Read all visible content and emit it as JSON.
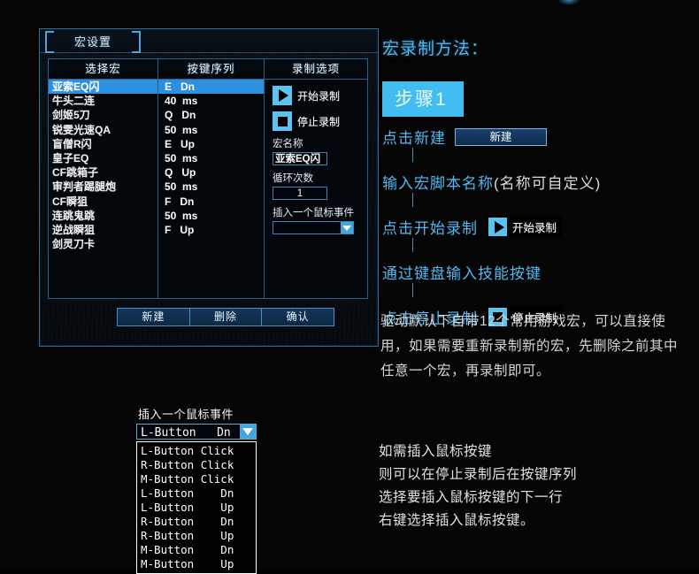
{
  "dialog": {
    "title": "宏设置",
    "columns": {
      "select_macro": "选择宏",
      "key_sequence": "按键序列",
      "record_options": "录制选项"
    },
    "macros": [
      "亚索EQ闪",
      "牛头二连",
      "剑姬5刀",
      "锐雯光速QA",
      "盲僧R闪",
      "皇子EQ",
      "CF跳箱子",
      "审判者踢腿炮",
      "CF瞬狙",
      "连跳鬼跳",
      "逆战瞬狙",
      "剑灵刀卡"
    ],
    "selected_macro_index": 0,
    "key_sequence": [
      "E   Dn",
      "40  ms",
      "Q   Dn",
      "50  ms",
      "E   Up",
      "50  ms",
      "Q   Up",
      "50  ms",
      "F   Dn",
      "50  ms",
      "F   Up"
    ],
    "record": {
      "start_label": "开始录制",
      "stop_label": "停止录制",
      "macro_name_label": "宏名称",
      "macro_name_value": "亚索EQ闪",
      "loop_count_label": "循环次数",
      "loop_count_value": "1",
      "insert_mouse_event_label": "插入一个鼠标事件",
      "insert_mouse_event_value": ""
    },
    "footer": {
      "new_label": "新建",
      "delete_label": "删除",
      "confirm_label": "确认"
    }
  },
  "guide": {
    "title": "宏录制方法：",
    "step_badge": "步骤1",
    "step1_text": "点击新建",
    "step1_button": "新建",
    "step2_text_blue": "输入宏脚本名称",
    "step2_text_grey": "(名称可自定义)",
    "step3_text": "点击开始录制",
    "step3_button": "开始录制",
    "step4_text": "通过键盘输入技能按键",
    "step5_text": "点击停止录制",
    "step5_button": "停止录制",
    "paragraph": "驱动默认下自带12个常用游戏宏，可以直接使用，如果需要重新录制新的宏，先删除之前其中任意一个宏，再录制即可。"
  },
  "popup": {
    "title": "插入一个鼠标事件",
    "selected_value": "L-Button   Dn",
    "options": [
      "L-Button Click",
      "R-Button Click",
      "M-Button Click",
      "L-Button    Dn",
      "L-Button    Up",
      "R-Button    Dn",
      "R-Button    Up",
      "M-Button    Dn",
      "M-Button    Up"
    ]
  },
  "bottom_note": {
    "line1": "如需插入鼠标按键",
    "line2": "则可以在停止录制后在按键序列",
    "line3": "选择要插入鼠标按键的下一行",
    "line4": "右键选择插入鼠标按键。"
  },
  "colors": {
    "accent_blue": "#41bdf2",
    "selection_blue": "#2d8fe0",
    "border_blue": "#2f6d96",
    "text_white": "#ffffff"
  }
}
